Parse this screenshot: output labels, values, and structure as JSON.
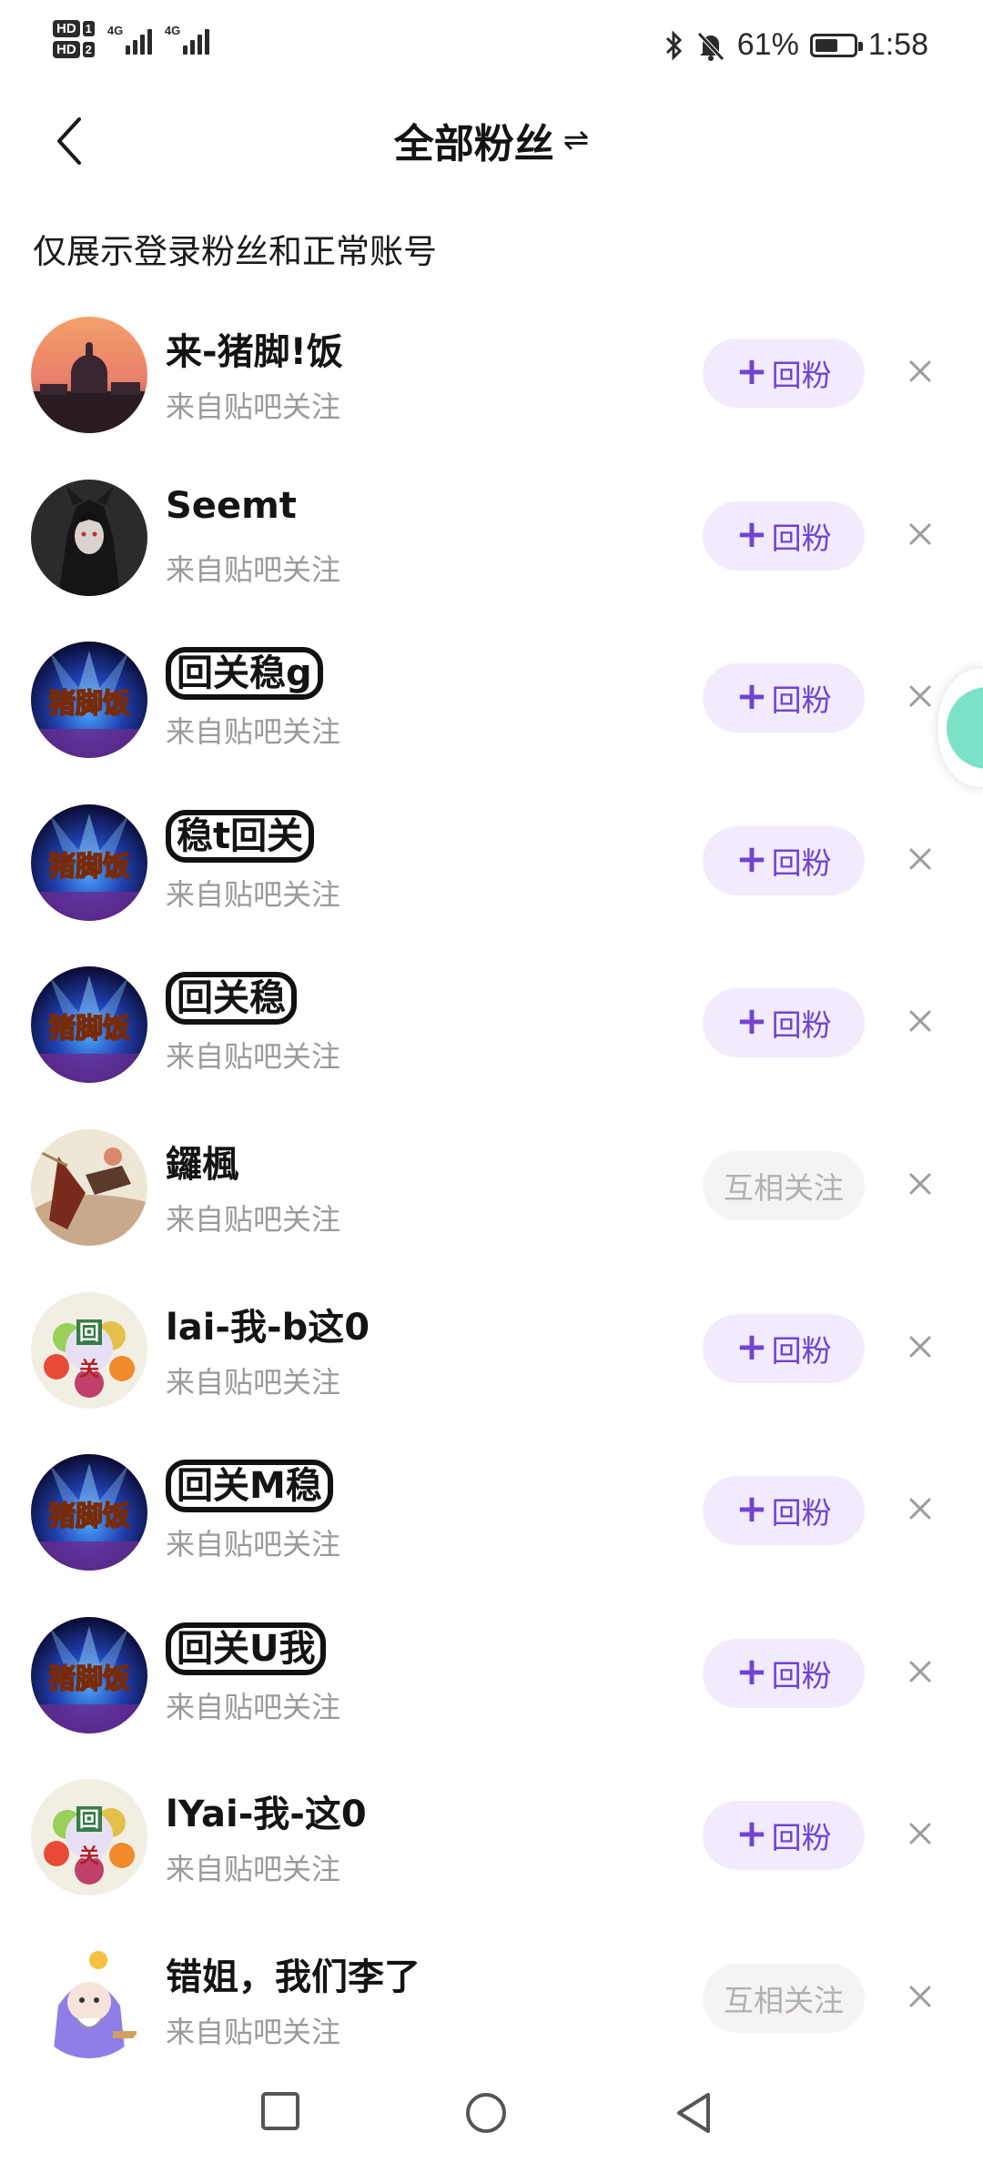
{
  "status_bar": {
    "sim1": {
      "badge": "HD",
      "num": "1",
      "net": "4G"
    },
    "sim2": {
      "badge": "HD",
      "num": "2",
      "net": "4G"
    },
    "battery_pct": "61%",
    "battery_level": 0.61,
    "time": "1:58"
  },
  "nav": {
    "title": "全部粉丝",
    "swap_glyph": "⇌"
  },
  "notice": "仅展示登录粉丝和正常账号",
  "follow_label": "回粉",
  "mutual_label": "互相关注",
  "followers": [
    {
      "name": "来-猪脚!饭",
      "source": "来自贴吧关注",
      "action": "follow",
      "avatar": "sunset-city"
    },
    {
      "name": "Seemt",
      "source": "来自贴吧关注",
      "action": "follow",
      "avatar": "dark-anime"
    },
    {
      "name": "回关稳g",
      "source": "来自贴吧关注",
      "action": "follow",
      "avatar": "zhujiaofan"
    },
    {
      "name": "稳t回关",
      "source": "来自贴吧关注",
      "action": "follow",
      "avatar": "zhujiaofan"
    },
    {
      "name": "回关稳",
      "source": "来自贴吧关注",
      "action": "follow",
      "avatar": "zhujiaofan"
    },
    {
      "name": "鑼楓",
      "source": "来自贴吧关注",
      "action": "mutual",
      "avatar": "painting"
    },
    {
      "name": "lai-我-b这0",
      "source": "来自贴吧关注",
      "action": "follow",
      "avatar": "fruit"
    },
    {
      "name": "回关M稳",
      "source": "来自贴吧关注",
      "action": "follow",
      "avatar": "zhujiaofan"
    },
    {
      "name": "回关U我",
      "source": "来自贴吧关注",
      "action": "follow",
      "avatar": "zhujiaofan"
    },
    {
      "name": "lYai-我-这0",
      "source": "来自贴吧关注",
      "action": "follow",
      "avatar": "fruit"
    },
    {
      "name": "错姐，我们李了",
      "source": "来自贴吧关注",
      "action": "mutual",
      "avatar": "cartoon"
    }
  ],
  "avatar_text": {
    "zhujiaofan": "猪脚饭",
    "fruit_top": "回",
    "fruit_bottom": "关"
  },
  "colors": {
    "accent": "#6f43d6",
    "button_bg": "#f1ebfd",
    "mutual_bg": "#f6f3f4",
    "mutual_text": "#b3b0b3",
    "secondary_text": "#9a9a9a",
    "float_badge": "#79e2c7"
  }
}
